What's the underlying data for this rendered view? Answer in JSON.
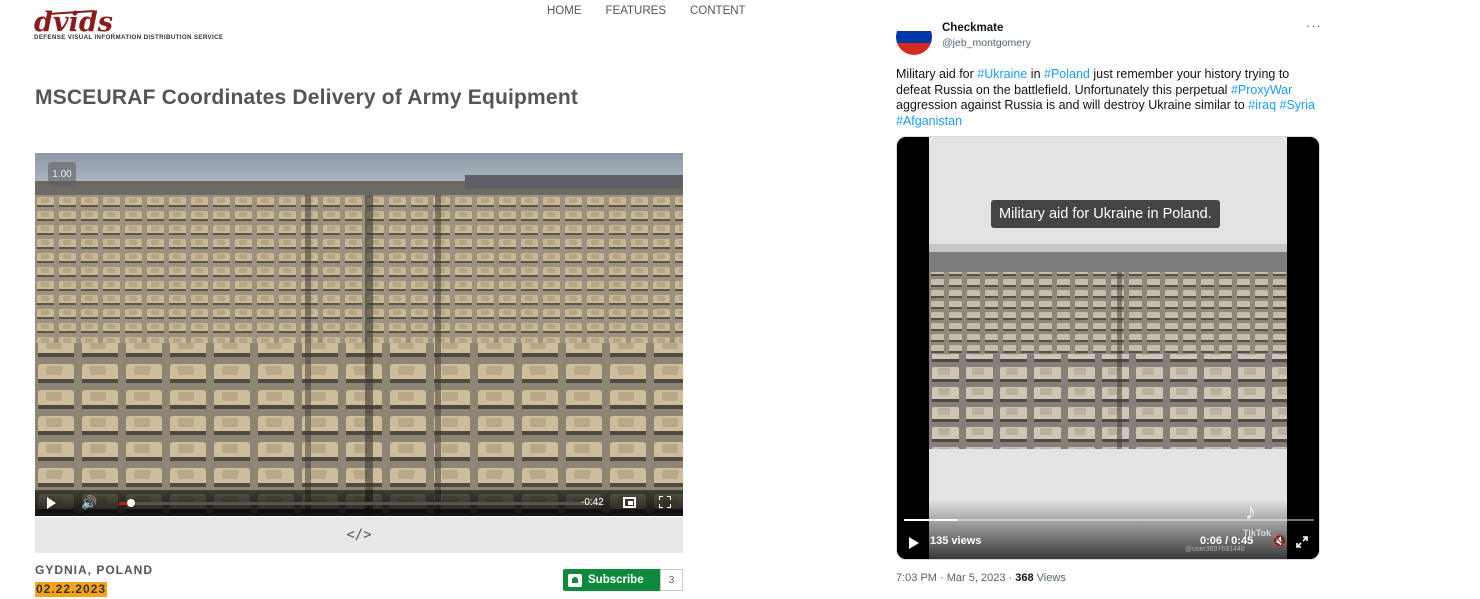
{
  "dvids": {
    "logo_text": "dvids",
    "logo_tagline": "Defense Visual Information Distribution Service",
    "nav": [
      "HOME",
      "FEATURES",
      "CONTENT"
    ],
    "title": "MSCEURAF Coordinates Delivery of Army Equipment",
    "video": {
      "playback_rate": "1.00",
      "time_remaining": "-0:42",
      "progress_fraction": 0.02,
      "icons": [
        "play-icon",
        "volume-icon",
        "picture-in-picture-icon",
        "fullscreen-icon"
      ]
    },
    "embed_label": "</>",
    "location": "GYDNIA, POLAND",
    "date": "02.22.2023",
    "subscribe_label": "Subscribe",
    "subscriber_count": "3",
    "colors": {
      "date_highlight": "#f7a21b",
      "subscribe": "#0f8a3d",
      "progress": "#c31c1c"
    }
  },
  "tweet": {
    "display_name": "Checkmate",
    "handle": "@jeb_montgomery",
    "more_label": "···",
    "text": {
      "t1": "Military aid for ",
      "h1": "#Ukraine",
      "t2": " in ",
      "h2": "#Poland",
      "t3": " just remember your history trying to defeat Russia on the battlefield. Unfortunately this perpetual ",
      "h3": "#ProxyWar",
      "t4": " aggression against Russia is and will destroy Ukraine similar to ",
      "h4": "#iraq",
      "t5": " ",
      "h5": "#Syria",
      "t6": " ",
      "h6": "#Afganistan"
    },
    "video": {
      "caption": "Military aid for Ukraine in Poland.",
      "views": "135 views",
      "time": "0:06 / 0:45",
      "progress_fraction": 0.13,
      "watermark": "TikTok",
      "user_tag": "@user3697691440"
    },
    "meta": {
      "timestamp": "7:03 PM · Mar 5, 2023 · ",
      "view_count": "368",
      "views_label": " Views"
    },
    "colors": {
      "hashtag": "#1d9bf0",
      "flag": [
        "#ffffff",
        "#0039a6",
        "#d52b1e"
      ]
    }
  }
}
